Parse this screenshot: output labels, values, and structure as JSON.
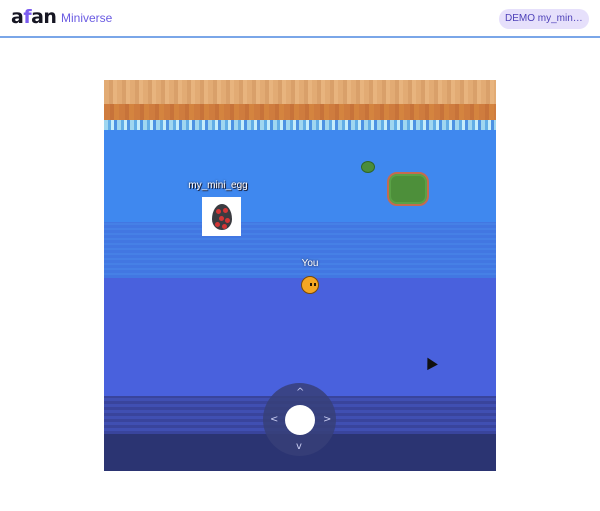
{
  "header": {
    "logo_prefix": "a",
    "logo_f": "f",
    "logo_suffix": "an",
    "app_name": "Miniverse",
    "demo_badge": "DEMO my_mini_eg..."
  },
  "game": {
    "npc": {
      "name": "my_mini_egg",
      "icon": "egg-icon"
    },
    "player": {
      "label": "You"
    },
    "joystick": {
      "up": "^",
      "down": "v",
      "left": "<",
      "right": ">"
    }
  },
  "colors": {
    "accent": "#7b5cf0",
    "header_border": "#7aa6e8",
    "water": "#3f88ef",
    "sand": "#e2ab74"
  }
}
